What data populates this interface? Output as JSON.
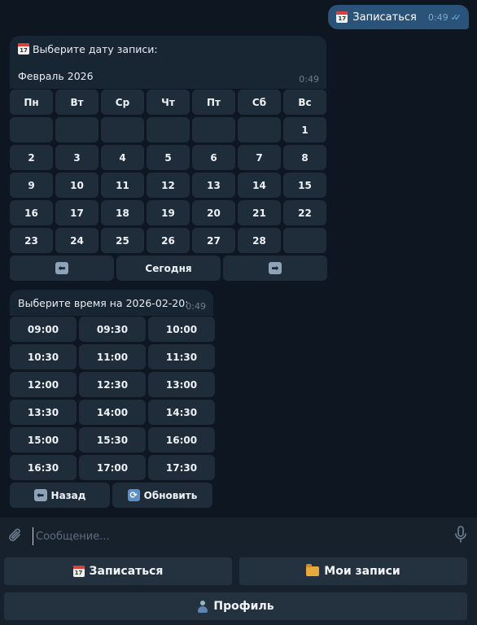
{
  "outgoing": {
    "text": "Записаться",
    "time": "0:49",
    "icon": "calendar-icon",
    "icon_day": "17"
  },
  "date_message": {
    "prompt": "Выберите дату записи:",
    "month": "Февраль 2026",
    "time": "0:49",
    "weekdays": [
      "Пн",
      "Вт",
      "Ср",
      "Чт",
      "Пт",
      "Сб",
      "Вс"
    ],
    "weeks": [
      [
        "",
        "",
        "",
        "",
        "",
        "",
        "1"
      ],
      [
        "2",
        "3",
        "4",
        "5",
        "6",
        "7",
        "8"
      ],
      [
        "9",
        "10",
        "11",
        "12",
        "13",
        "14",
        "15"
      ],
      [
        "16",
        "17",
        "18",
        "19",
        "20",
        "21",
        "22"
      ],
      [
        "23",
        "24",
        "25",
        "26",
        "27",
        "28",
        ""
      ]
    ],
    "nav": {
      "prev": "⬅",
      "today": "Сегодня",
      "next": "➡"
    }
  },
  "time_message": {
    "prompt": "Выберите время на 2026-02-20:",
    "time": "0:49",
    "slots": [
      [
        "09:00",
        "09:30",
        "10:00"
      ],
      [
        "10:30",
        "11:00",
        "11:30"
      ],
      [
        "12:00",
        "12:30",
        "13:00"
      ],
      [
        "13:30",
        "14:00",
        "14:30"
      ],
      [
        "15:00",
        "15:30",
        "16:00"
      ],
      [
        "16:30",
        "17:00",
        "17:30"
      ]
    ],
    "back_label": "Назад",
    "refresh_label": "Обновить"
  },
  "composer": {
    "placeholder": "Сообщение..."
  },
  "reply_keyboard": {
    "book_label": "Записаться",
    "my_bookings_label": "Мои записи",
    "profile_label": "Профиль"
  },
  "colors": {
    "background": "#0e1621",
    "bubble_in": "#182533",
    "bubble_out": "#2b5278",
    "button": "#1f2c3a"
  }
}
